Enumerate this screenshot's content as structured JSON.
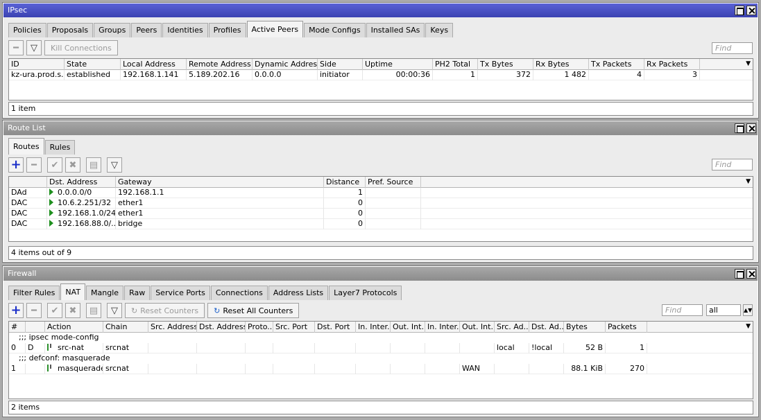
{
  "ipsec": {
    "title": "IPsec",
    "tabs": [
      "Policies",
      "Proposals",
      "Groups",
      "Peers",
      "Identities",
      "Profiles",
      "Active Peers",
      "Mode Configs",
      "Installed SAs",
      "Keys"
    ],
    "selected_tab": "Active Peers",
    "kill_label": "Kill Connections",
    "find_placeholder": "Find",
    "columns": [
      "ID",
      "State",
      "Local Address",
      "Remote Address",
      "Dynamic Address",
      "Side",
      "Uptime",
      "PH2 Total",
      "Tx Bytes",
      "Rx Bytes",
      "Tx Packets",
      "Rx Packets"
    ],
    "rows": [
      {
        "id": "kz-ura.prod.s...",
        "state": "established",
        "local": "192.168.1.141",
        "remote": "5.189.202.16",
        "dynamic": "0.0.0.0",
        "side": "initiator",
        "uptime": "00:00:36",
        "ph2": "1",
        "tx_bytes": "372",
        "rx_bytes": "1 482",
        "tx_packets": "4",
        "rx_packets": "3"
      }
    ],
    "status": "1 item"
  },
  "routes": {
    "title": "Route List",
    "tabs": [
      "Routes",
      "Rules"
    ],
    "selected_tab": "Routes",
    "find_placeholder": "Find",
    "columns": [
      "Dst. Address",
      "Gateway",
      "Distance",
      "Pref. Source"
    ],
    "rows": [
      {
        "flags": "DAd",
        "dst": "0.0.0.0/0",
        "gateway": "192.168.1.1",
        "distance": "1",
        "pref": ""
      },
      {
        "flags": "DAC",
        "dst": "10.6.2.251/32",
        "gateway": "ether1",
        "distance": "0",
        "pref": ""
      },
      {
        "flags": "DAC",
        "dst": "192.168.1.0/24",
        "gateway": "ether1",
        "distance": "0",
        "pref": ""
      },
      {
        "flags": "DAC",
        "dst": "192.168.88.0/...",
        "gateway": "bridge",
        "distance": "0",
        "pref": ""
      }
    ],
    "status": "4 items out of 9"
  },
  "firewall": {
    "title": "Firewall",
    "tabs": [
      "Filter Rules",
      "NAT",
      "Mangle",
      "Raw",
      "Service Ports",
      "Connections",
      "Address Lists",
      "Layer7 Protocols"
    ],
    "selected_tab": "NAT",
    "reset_label": "Reset Counters",
    "reset_all_label": "Reset All Counters",
    "find_placeholder": "Find",
    "filter_value": "all",
    "columns": [
      "#",
      "Action",
      "Chain",
      "Src. Address",
      "Dst. Address",
      "Proto...",
      "Src. Port",
      "Dst. Port",
      "In. Inter...",
      "Out. Int...",
      "In. Inter...",
      "Out. Int...",
      "Src. Ad...",
      "Dst. Ad...",
      "Bytes",
      "Packets"
    ],
    "comment1": ";;; ipsec mode-config",
    "comment2": ";;; defconf: masquerade",
    "rows": [
      {
        "num": "0",
        "flag": "D",
        "action": "src-nat",
        "chain": "srcnat",
        "out_int": "",
        "src_ad": "local",
        "dst_ad": "!local",
        "bytes": "52 B",
        "packets": "1"
      },
      {
        "num": "1",
        "flag": "",
        "action": "masquerade",
        "chain": "srcnat",
        "out_int": "WAN",
        "src_ad": "",
        "dst_ad": "",
        "bytes": "88.1 KiB",
        "packets": "270"
      }
    ],
    "status": "2 items"
  }
}
